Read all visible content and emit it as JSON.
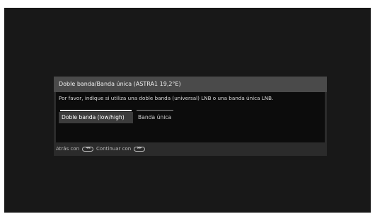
{
  "dialog": {
    "title": "Doble banda/Banda única (ASTRA1 19,2°E)",
    "prompt": "Por favor, indique si utiliza una doble banda (universal) LNB o una banda única LNB.",
    "options": [
      {
        "label": "Doble banda (low/high)",
        "selected": true
      },
      {
        "label": "Banda única",
        "selected": false
      }
    ],
    "footer": {
      "back_text": "Atrás con",
      "continue_text": "Continuar con",
      "back_key_icon": "rewind-key-icon",
      "continue_key_icon": "fast-forward-key-icon"
    }
  },
  "colors": {
    "screen_background": "#181818",
    "dialog_title_bar": "#4a4a4a",
    "dialog_body": "#0c0c0c",
    "selected_option": "#3c3c3c"
  }
}
